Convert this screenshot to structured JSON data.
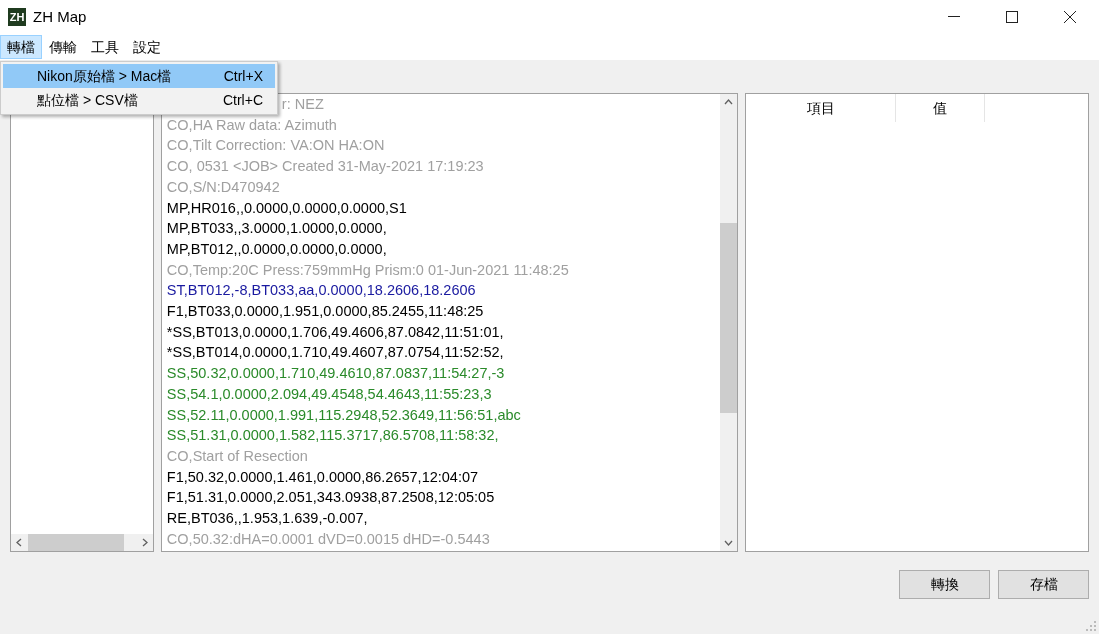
{
  "window": {
    "title": "ZH Map",
    "logo": "ZH"
  },
  "menu_bar": [
    {
      "label": "轉檔",
      "selected": true
    },
    {
      "label": "傳輸",
      "selected": false
    },
    {
      "label": "工具",
      "selected": false
    },
    {
      "label": "設定",
      "selected": false
    }
  ],
  "dropdown": [
    {
      "label": "Nikon原始檔 > Mac檔",
      "shortcut": "Ctrl+X",
      "selected": true
    },
    {
      "label": "點位檔 > CSV檔",
      "shortcut": "Ctrl+C",
      "selected": false
    }
  ],
  "text_lines": [
    {
      "text": "r: NEZ",
      "kind": "comment"
    },
    {
      "text": "CO,HA Raw data: Azimuth",
      "kind": "comment"
    },
    {
      "text": "CO,Tilt Correction:  VA:ON HA:ON",
      "kind": "comment"
    },
    {
      "text": "CO, 0531 <JOB> Created 31-May-2021 17:19:23",
      "kind": "comment"
    },
    {
      "text": "CO,S/N:D470942",
      "kind": "comment"
    },
    {
      "text": "MP,HR016,,0.0000,0.0000,0.0000,S1",
      "kind": "data"
    },
    {
      "text": "MP,BT033,,3.0000,1.0000,0.0000,",
      "kind": "data"
    },
    {
      "text": "MP,BT012,,0.0000,0.0000,0.0000,",
      "kind": "data"
    },
    {
      "text": "CO,Temp:20C Press:759mmHg Prism:0 01-Jun-2021 11:48:25",
      "kind": "comment"
    },
    {
      "text": "ST,BT012,-8,BT033,aa,0.0000,18.2606,18.2606",
      "kind": "station"
    },
    {
      "text": "F1,BT033,0.0000,1.951,0.0000,85.2455,11:48:25",
      "kind": "data"
    },
    {
      "text": "*SS,BT013,0.0000,1.706,49.4606,87.0842,11:51:01,",
      "kind": "data"
    },
    {
      "text": "*SS,BT014,0.0000,1.710,49.4607,87.0754,11:52:52,",
      "kind": "data"
    },
    {
      "text": "SS,50.32,0.0000,1.710,49.4610,87.0837,11:54:27,-3",
      "kind": "shot"
    },
    {
      "text": "SS,54.1,0.0000,2.094,49.4548,54.4643,11:55:23,3",
      "kind": "shot"
    },
    {
      "text": "SS,52.11,0.0000,1.991,115.2948,52.3649,11:56:51,abc",
      "kind": "shot"
    },
    {
      "text": "SS,51.31,0.0000,1.582,115.3717,86.5708,11:58:32,",
      "kind": "shot"
    },
    {
      "text": "CO,Start of Resection",
      "kind": "comment"
    },
    {
      "text": "F1,50.32,0.0000,1.461,0.0000,86.2657,12:04:07",
      "kind": "data"
    },
    {
      "text": "F1,51.31,0.0000,2.051,343.0938,87.2508,12:05:05",
      "kind": "data"
    },
    {
      "text": "RE,BT036,,1.953,1.639,-0.007,",
      "kind": "data"
    },
    {
      "text": "CO,50.32:dHA=0.0001 dVD=0.0015 dHD=-0.5443",
      "kind": "comment"
    }
  ],
  "table": {
    "columns": [
      "項目",
      "值"
    ]
  },
  "buttons": [
    "轉換",
    "存檔"
  ]
}
